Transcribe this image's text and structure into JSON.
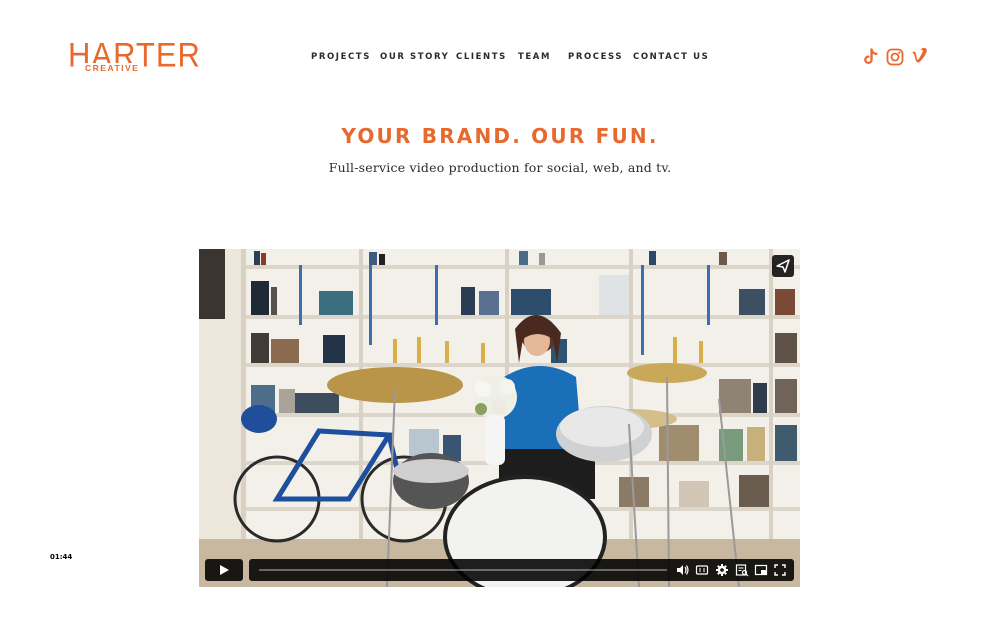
{
  "brand": {
    "logo_main": "HARTER",
    "logo_sub": "CREATIVE",
    "accent_color": "#e8692d"
  },
  "nav": {
    "items": [
      {
        "label": "PROJECTS"
      },
      {
        "label": "OUR STORY"
      },
      {
        "label": "CLIENTS"
      },
      {
        "label": "TEAM"
      },
      {
        "label": "PROCESS"
      },
      {
        "label": "CONTACT US"
      }
    ]
  },
  "social": [
    {
      "icon": "tiktok-icon"
    },
    {
      "icon": "instagram-icon"
    },
    {
      "icon": "vimeo-icon"
    }
  ],
  "hero": {
    "title": "YOUR BRAND. OUR FUN.",
    "subtitle": "Full-service video production for social, web, and tv."
  },
  "video": {
    "duration": "01:44",
    "progress": 0,
    "controls": [
      "play-icon",
      "volume-icon",
      "captions-icon",
      "settings-icon",
      "transcript-icon",
      "pip-icon",
      "fullscreen-icon"
    ],
    "share_icon": "share-icon"
  }
}
